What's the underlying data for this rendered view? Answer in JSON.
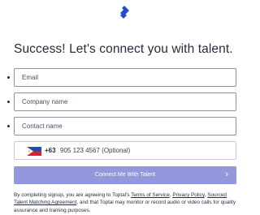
{
  "logo": {
    "icon": "toptal-logo-icon",
    "color": "#204ecf"
  },
  "heading": "Success! Let's connect you with talent.",
  "form": {
    "email_placeholder": "Email",
    "company_placeholder": "Company name",
    "contact_placeholder": "Contact name",
    "phone": {
      "country": "Philippines",
      "flag_icon": "philippines-flag-icon",
      "dial_code": "+63",
      "placeholder": "905 123 4567 (Optional)"
    },
    "submit_label": "Connect Me With Talent",
    "submit_icon": "chevron-right-icon",
    "button_color": "#9597dd"
  },
  "terms": {
    "prefix": "By completing signup, you are agreeing to Toptal's ",
    "terms_link": "Terms of Service",
    "sep1": ", ",
    "privacy_link": "Privacy Policy",
    "sep2": ", ",
    "matching_link": "Sourced Talent Matching Agreement",
    "suffix": ", and that Toptal may monitor or record audio or video calls for quality assurance and training purposes."
  }
}
